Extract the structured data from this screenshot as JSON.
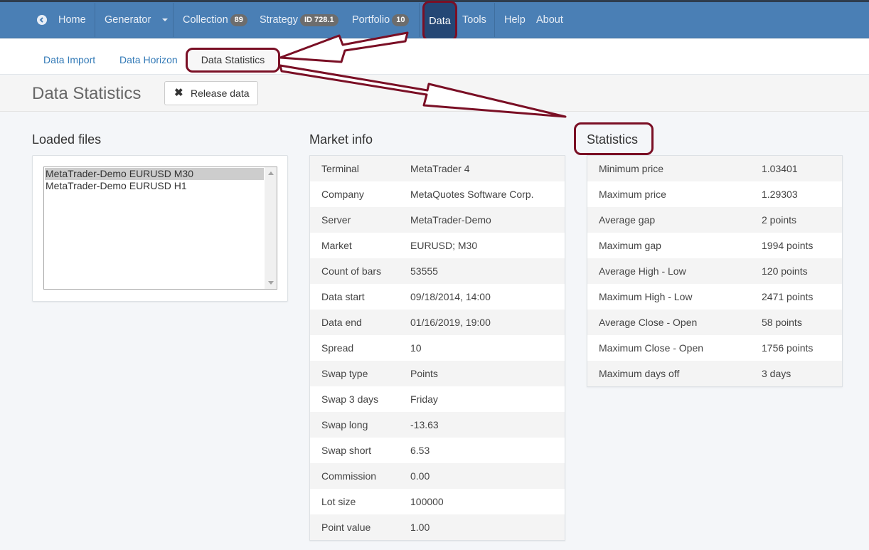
{
  "navbar": {
    "items": {
      "home": "Home",
      "generator": "Generator",
      "collection": "Collection",
      "collection_badge": "89",
      "strategy": "Strategy",
      "strategy_badge": "ID 728.1",
      "portfolio": "Portfolio",
      "portfolio_badge": "10",
      "data": "Data",
      "tools": "Tools",
      "help": "Help",
      "about": "About"
    },
    "icons": {
      "home": "arrow-left-circle-icon",
      "generator_menu": "caret-down-icon"
    },
    "colors": {
      "bar": "#4a7fb5",
      "active": "#244775",
      "highlight": "#7a0f25"
    }
  },
  "subnav": {
    "data_import": "Data Import",
    "data_horizon": "Data Horizon",
    "data_statistics": "Data Statistics"
  },
  "header": {
    "title": "Data Statistics",
    "release_button": "Release data",
    "release_icon": "x-icon"
  },
  "loaded_files": {
    "title": "Loaded files",
    "files": [
      "MetaTrader-Demo EURUSD M30",
      "MetaTrader-Demo EURUSD H1"
    ],
    "selected": "MetaTrader-Demo EURUSD M30"
  },
  "market_info": {
    "title": "Market info",
    "rows": [
      {
        "label": "Terminal",
        "value": "MetaTrader 4"
      },
      {
        "label": "Company",
        "value": "MetaQuotes Software Corp."
      },
      {
        "label": "Server",
        "value": "MetaTrader-Demo"
      },
      {
        "label": "Market",
        "value": "EURUSD; M30"
      },
      {
        "label": "Count of bars",
        "value": "53555"
      },
      {
        "label": "Data start",
        "value": "09/18/2014, 14:00"
      },
      {
        "label": "Data end",
        "value": "01/16/2019, 19:00"
      },
      {
        "label": "Spread",
        "value": "10"
      },
      {
        "label": "Swap type",
        "value": "Points"
      },
      {
        "label": "Swap 3 days",
        "value": "Friday"
      },
      {
        "label": "Swap long",
        "value": "-13.63"
      },
      {
        "label": "Swap short",
        "value": "6.53"
      },
      {
        "label": "Commission",
        "value": "0.00"
      },
      {
        "label": "Lot size",
        "value": "100000"
      },
      {
        "label": "Point value",
        "value": "1.00"
      }
    ]
  },
  "statistics": {
    "title": "Statistics",
    "rows": [
      {
        "label": "Minimum price",
        "value": "1.03401"
      },
      {
        "label": "Maximum price",
        "value": "1.29303"
      },
      {
        "label": "Average gap",
        "value": "2 points"
      },
      {
        "label": "Maximum gap",
        "value": "1994 points"
      },
      {
        "label": "Average High - Low",
        "value": "120 points"
      },
      {
        "label": "Maximum High - Low",
        "value": "2471 points"
      },
      {
        "label": "Average Close - Open",
        "value": "58 points"
      },
      {
        "label": "Maximum Close - Open",
        "value": "1756 points"
      },
      {
        "label": "Maximum days off",
        "value": "3 days"
      }
    ]
  }
}
